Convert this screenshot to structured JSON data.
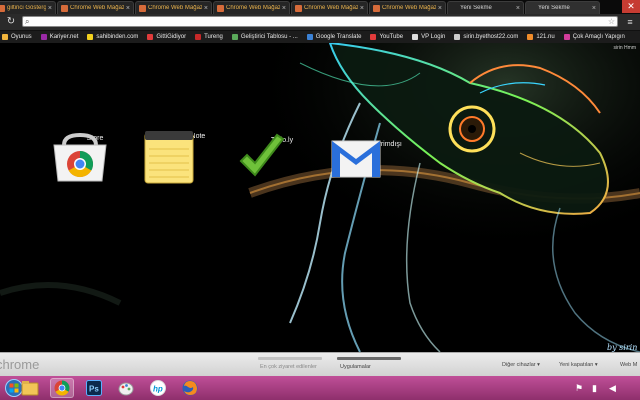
{
  "tabs": [
    {
      "title": "giltirici Gösterge",
      "active": false
    },
    {
      "title": "Chrome Web Mağaz",
      "active": false
    },
    {
      "title": "Chrome Web Mağaz",
      "active": false
    },
    {
      "title": "Chrome Web Mağaz",
      "active": false
    },
    {
      "title": "Chrome Web Mağaz",
      "active": false
    },
    {
      "title": "Chrome Web Mağaz",
      "active": false
    },
    {
      "title": "Yeni Sekme",
      "active": false
    },
    {
      "title": "Yeni Sekme",
      "active": true
    }
  ],
  "omnibox": {
    "value": ""
  },
  "bookmarks": [
    {
      "label": "Oyunus",
      "color": "#f0b43c"
    },
    {
      "label": "Kariyer.net",
      "color": "#9a2aa6"
    },
    {
      "label": "sahibinden.com",
      "color": "#f3d11e"
    },
    {
      "label": "GittiGidiyor",
      "color": "#e03b3b"
    },
    {
      "label": "Tureng",
      "color": "#c62828"
    },
    {
      "label": "Geliştirici Tablosu - ...",
      "color": "#5aa95a"
    },
    {
      "label": "Google Translate",
      "color": "#3b82d6"
    },
    {
      "label": "YouTube",
      "color": "#e23b3b"
    },
    {
      "label": "VP Login",
      "color": "#dddddd"
    },
    {
      "label": "sirin.byethost22.com",
      "color": "#cccccc"
    },
    {
      "label": "121.nu",
      "color": "#f08c2a"
    },
    {
      "label": "Çok Amaçlı Yapıgın",
      "color": "#d23c9a"
    }
  ],
  "user_sign": "sirin Hmm",
  "apps": [
    {
      "label": "Store"
    },
    {
      "label": "Quick Note"
    },
    {
      "label": "Todo.ly"
    },
    {
      "label": "Gmail Çevrimdışı"
    }
  ],
  "byline": "by sirin",
  "footer": {
    "logo": "chrome",
    "pages": [
      {
        "label": "En çok ziyaret edilenler",
        "active": false
      },
      {
        "label": "Uygulamalar",
        "active": true
      }
    ],
    "other_devices": "Diğer cihazlar",
    "recently_closed": "Yeni kapatılan",
    "web_store": "Web M"
  },
  "taskbar": {
    "items": [
      "windows-start",
      "explorer",
      "chrome",
      "photoshop",
      "paint",
      "hp",
      "firefox"
    ],
    "active_index": 2
  },
  "colors": {
    "tab_title_loading": "#e9b24d",
    "taskbar": "#b14589",
    "close_button": "#c63c32"
  }
}
